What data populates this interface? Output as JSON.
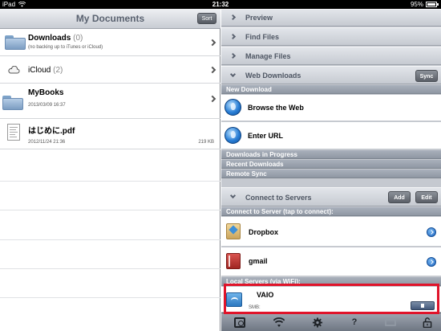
{
  "status": {
    "carrier": "iPad",
    "time": "21:32",
    "battery": "95%"
  },
  "left": {
    "title": "My Documents",
    "sort_label": "Sort",
    "items": [
      {
        "name": "Downloads",
        "count": "(0)",
        "sub": "(no backing up to iTunes or iCloud)",
        "icon": "folder-icon"
      },
      {
        "name": "iCloud",
        "count": "(2)",
        "sub": "",
        "icon": "cloud-icon"
      },
      {
        "name": "MyBooks",
        "count": "",
        "sub": "2013/03/09 16:37",
        "icon": "folder-icon"
      },
      {
        "name": "はじめに.pdf",
        "count": "",
        "sub": "2012/11/24 21:36",
        "size": "219 KB",
        "icon": "pdf-file-icon"
      }
    ]
  },
  "right": {
    "sections": {
      "preview": "Preview",
      "find_files": "Find Files",
      "manage_files": "Manage Files",
      "web_downloads": "Web Downloads",
      "sync_label": "Sync",
      "connect_to_servers": "Connect to Servers",
      "add_label": "Add",
      "edit_label": "Edit"
    },
    "new_download": {
      "header": "New Download",
      "browse": "Browse the Web",
      "enter_url": "Enter URL"
    },
    "downloads_in_progress": "Downloads in Progress",
    "recent_downloads": "Recent Downloads",
    "remote_sync": "Remote Sync",
    "connect_header": "Connect to Server (tap to connect):",
    "servers": [
      {
        "name": "Dropbox"
      },
      {
        "name": "gmail"
      }
    ],
    "local_servers_header": "Local Servers (via WiFi):",
    "local": {
      "name": "VAIO",
      "sub": "SMB:"
    }
  },
  "toolbar": {
    "help": "?"
  },
  "colors": {
    "highlight": "#e0142a",
    "accent_blue": "#2a7fd6"
  }
}
